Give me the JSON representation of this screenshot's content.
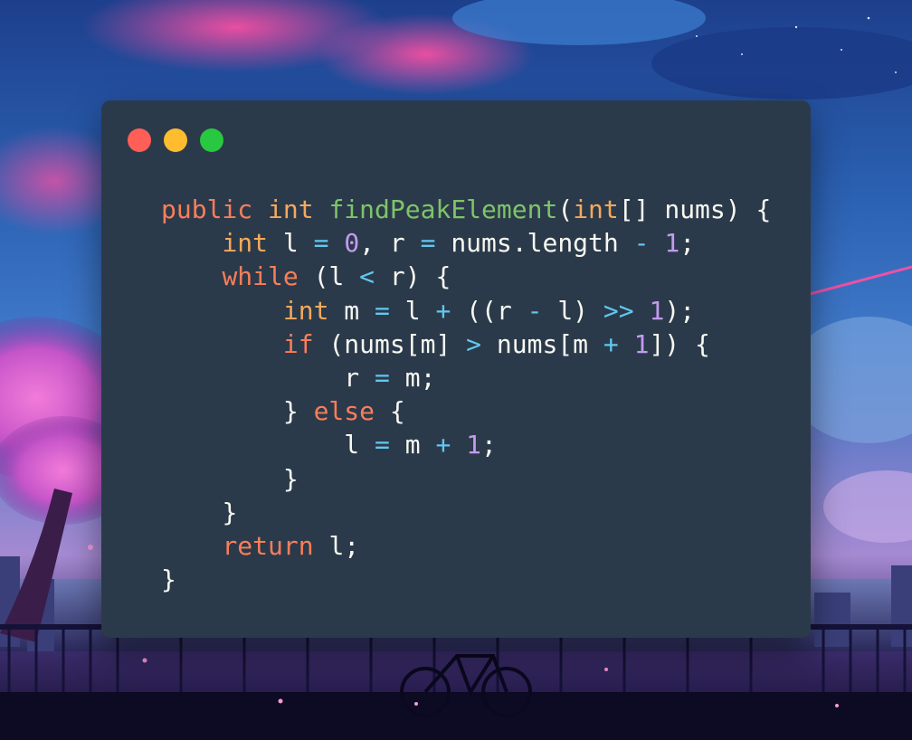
{
  "window": {
    "controls": {
      "close": "close-dot",
      "minimize": "minimize-dot",
      "zoom": "zoom-dot",
      "colors": {
        "close": "#ff5f57",
        "minimize": "#febc2e",
        "zoom": "#28c840"
      }
    },
    "background_color": "#2b3a4a"
  },
  "code": {
    "language": "java",
    "lines": [
      {
        "indent": "",
        "tokens": [
          {
            "t": "public",
            "c": "kw"
          },
          {
            "t": " ",
            "c": "id"
          },
          {
            "t": "int",
            "c": "ty"
          },
          {
            "t": " ",
            "c": "id"
          },
          {
            "t": "findPeakElement",
            "c": "fn"
          },
          {
            "t": "(",
            "c": "id"
          },
          {
            "t": "int",
            "c": "ty"
          },
          {
            "t": "[] nums) {",
            "c": "id"
          }
        ]
      },
      {
        "indent": "    ",
        "tokens": [
          {
            "t": "int",
            "c": "ty"
          },
          {
            "t": " l ",
            "c": "id"
          },
          {
            "t": "=",
            "c": "op"
          },
          {
            "t": " ",
            "c": "id"
          },
          {
            "t": "0",
            "c": "num"
          },
          {
            "t": ", r ",
            "c": "id"
          },
          {
            "t": "=",
            "c": "op"
          },
          {
            "t": " nums.length ",
            "c": "id"
          },
          {
            "t": "-",
            "c": "op"
          },
          {
            "t": " ",
            "c": "id"
          },
          {
            "t": "1",
            "c": "num"
          },
          {
            "t": ";",
            "c": "id"
          }
        ]
      },
      {
        "indent": "    ",
        "tokens": [
          {
            "t": "while",
            "c": "kw"
          },
          {
            "t": " (l ",
            "c": "id"
          },
          {
            "t": "<",
            "c": "op"
          },
          {
            "t": " r) {",
            "c": "id"
          }
        ]
      },
      {
        "indent": "        ",
        "tokens": [
          {
            "t": "int",
            "c": "ty"
          },
          {
            "t": " m ",
            "c": "id"
          },
          {
            "t": "=",
            "c": "op"
          },
          {
            "t": " l ",
            "c": "id"
          },
          {
            "t": "+",
            "c": "op"
          },
          {
            "t": " ((r ",
            "c": "id"
          },
          {
            "t": "-",
            "c": "op"
          },
          {
            "t": " l) ",
            "c": "id"
          },
          {
            "t": ">>",
            "c": "op"
          },
          {
            "t": " ",
            "c": "id"
          },
          {
            "t": "1",
            "c": "num"
          },
          {
            "t": ");",
            "c": "id"
          }
        ]
      },
      {
        "indent": "        ",
        "tokens": [
          {
            "t": "if",
            "c": "kw"
          },
          {
            "t": " (nums[m] ",
            "c": "id"
          },
          {
            "t": ">",
            "c": "op"
          },
          {
            "t": " nums[m ",
            "c": "id"
          },
          {
            "t": "+",
            "c": "op"
          },
          {
            "t": " ",
            "c": "id"
          },
          {
            "t": "1",
            "c": "num"
          },
          {
            "t": "]) {",
            "c": "id"
          }
        ]
      },
      {
        "indent": "            ",
        "tokens": [
          {
            "t": "r ",
            "c": "id"
          },
          {
            "t": "=",
            "c": "op"
          },
          {
            "t": " m;",
            "c": "id"
          }
        ]
      },
      {
        "indent": "        ",
        "tokens": [
          {
            "t": "} ",
            "c": "id"
          },
          {
            "t": "else",
            "c": "kw"
          },
          {
            "t": " {",
            "c": "id"
          }
        ]
      },
      {
        "indent": "            ",
        "tokens": [
          {
            "t": "l ",
            "c": "id"
          },
          {
            "t": "=",
            "c": "op"
          },
          {
            "t": " m ",
            "c": "id"
          },
          {
            "t": "+",
            "c": "op"
          },
          {
            "t": " ",
            "c": "id"
          },
          {
            "t": "1",
            "c": "num"
          },
          {
            "t": ";",
            "c": "id"
          }
        ]
      },
      {
        "indent": "        ",
        "tokens": [
          {
            "t": "}",
            "c": "id"
          }
        ]
      },
      {
        "indent": "    ",
        "tokens": [
          {
            "t": "}",
            "c": "id"
          }
        ]
      },
      {
        "indent": "    ",
        "tokens": [
          {
            "t": "return",
            "c": "kw"
          },
          {
            "t": " l;",
            "c": "id"
          }
        ]
      },
      {
        "indent": "",
        "tokens": [
          {
            "t": "}",
            "c": "id"
          }
        ]
      }
    ]
  },
  "syntax_colors": {
    "keyword": "#f97e5a",
    "type": "#f5a95c",
    "function": "#7ec46a",
    "number": "#c39bf0",
    "operator": "#62c7f0",
    "identifier": "#f8f8f2"
  }
}
